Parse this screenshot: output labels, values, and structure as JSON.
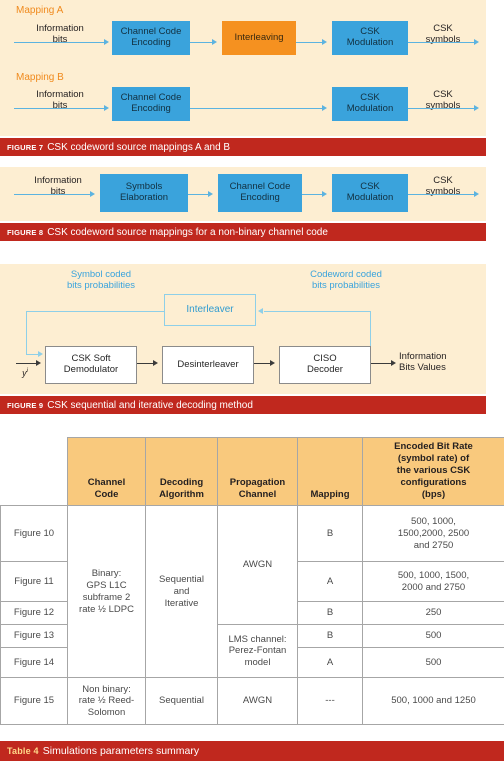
{
  "figure7": {
    "mapping_a_label": "Mapping A",
    "mapping_b_label": "Mapping B",
    "a_input": "Information\nbits",
    "a_block1": "Channel Code\nEncoding",
    "a_block2": "Interleaving",
    "a_block3": "CSK\nModulation",
    "a_output": "CSK\nsymbols",
    "b_input": "Information\nbits",
    "b_block1": "Channel Code\nEncoding",
    "b_block2": "CSK\nModulation",
    "b_output": "CSK\nsymbols",
    "caption_num": "FIGURE 7",
    "caption_text": "CSK codeword source mappings A and B"
  },
  "figure8": {
    "input": "Information\nbits",
    "block1": "Symbols\nElaboration",
    "block2": "Channel Code\nEncoding",
    "block3": "CSK\nModulation",
    "output": "CSK\nsymbols",
    "caption_num": "FIGURE 8",
    "caption_text": "CSK codeword source mappings for a non-binary channel code"
  },
  "figure9": {
    "label_left": "Symbol coded\nbits probabilities",
    "label_right": "Codeword coded\nbits probabilities",
    "interleaver": "Interleaver",
    "input_signal": "y",
    "input_signal_sup": "i",
    "block1": "CSK Soft\nDemodulator",
    "block2": "Desinterleaver",
    "block3": "CISO\nDecoder",
    "output": "Information\nBits Values",
    "caption_num": "FIGURE 9",
    "caption_text": "CSK sequential and iterative decoding method"
  },
  "table": {
    "headers": [
      "",
      "Channel\nCode",
      "Decoding\nAlgorithm",
      "Propagation\nChannel",
      "Mapping",
      "Encoded Bit Rate\n(symbol rate) of\nthe various CSK\nconfigurations\n(bps)"
    ],
    "rows": [
      {
        "figure": "Figure 10",
        "mapping": "B",
        "bitrate": "500, 1000,\n1500,2000, 2500\nand 2750"
      },
      {
        "figure": "Figure 11",
        "mapping": "A",
        "bitrate": "500, 1000, 1500,\n2000 and 2750"
      },
      {
        "figure": "Figure 12",
        "mapping": "B",
        "bitrate": "250"
      },
      {
        "figure": "Figure 13",
        "mapping": "B",
        "bitrate": "500"
      },
      {
        "figure": "Figure 14",
        "mapping": "A",
        "bitrate": "500"
      },
      {
        "figure": "Figure 15",
        "mapping": "---",
        "bitrate": "500, 1000 and 1250"
      }
    ],
    "channel_code_binary": "Binary:\nGPS L1C\nsubframe 2\nrate ½ LDPC",
    "channel_code_nonbinary": "Non binary:\nrate ½ Reed-\nSolomon",
    "decoding_seq_iter": "Sequential\nand\nIterative",
    "decoding_seq": "Sequential",
    "channel_awgn": "AWGN",
    "channel_lms": "LMS channel:\nPerez-Fontan\nmodel",
    "channel_awgn2": "AWGN",
    "caption_num": "Table 4",
    "caption_text": "Simulations parameters summary"
  },
  "colors": {
    "panel_bg": "#fdeed2",
    "caption_bar": "#c0281e",
    "block_blue": "#3aa3dc",
    "block_orange": "#f59120",
    "header_orange": "#f9c97d",
    "mapping_label": "#f08a1d"
  }
}
